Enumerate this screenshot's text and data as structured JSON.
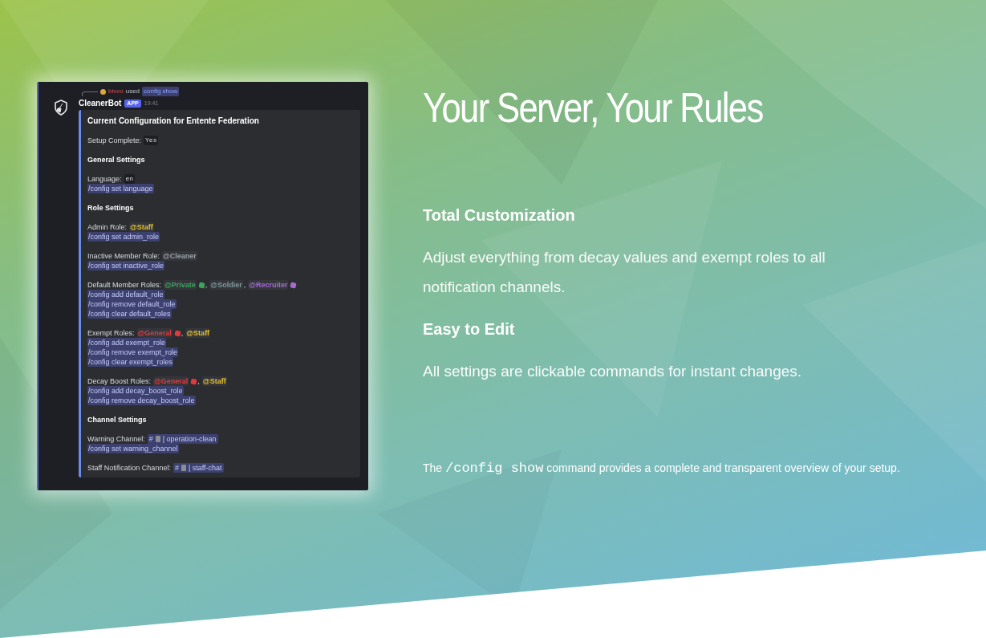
{
  "screenshot": {
    "reply": {
      "user": "bivvo",
      "verb": "used",
      "command": "config show"
    },
    "bot": {
      "name": "CleanerBot",
      "badge": "APP",
      "time": "19:41"
    },
    "embed": {
      "title": "Current Configuration for Entente Federation",
      "blocks": [
        {
          "kind": "field",
          "label": "Setup Complete:",
          "values": [
            {
              "kind": "code",
              "text": "Yes"
            }
          ]
        },
        {
          "kind": "heading",
          "text": "General Settings"
        },
        {
          "kind": "field",
          "label": "Language:",
          "values": [
            {
              "kind": "code",
              "text": "en"
            }
          ],
          "commands": [
            "/config set language"
          ]
        },
        {
          "kind": "heading",
          "text": "Role Settings"
        },
        {
          "kind": "field",
          "label": "Admin Role:",
          "values": [
            {
              "kind": "role",
              "text": "@Staff",
              "color": "#e8c12c",
              "has_icon": false
            }
          ],
          "commands": [
            "/config set admin_role"
          ]
        },
        {
          "kind": "field",
          "label": "Inactive Member Role:",
          "values": [
            {
              "kind": "role",
              "text": "@Cleaner",
              "color": "#9aa0a6",
              "has_icon": false
            }
          ],
          "commands": [
            "/config set inactive_role"
          ]
        },
        {
          "kind": "field",
          "label": "Default Member Roles:",
          "values": [
            {
              "kind": "role",
              "text": "@Private",
              "color": "#3ba55c",
              "has_icon": true
            },
            {
              "kind": "plain",
              "text": ","
            },
            {
              "kind": "role",
              "text": "@Soldier",
              "color": "#7f9c9c",
              "has_icon": false
            },
            {
              "kind": "plain",
              "text": ","
            },
            {
              "kind": "role",
              "text": "@Recruiter",
              "color": "#a56bd1",
              "has_icon": true
            }
          ],
          "commands": [
            "/config add default_role",
            "/config remove default_role",
            "/config clear default_roles"
          ]
        },
        {
          "kind": "field",
          "label": "Exempt Roles:",
          "values": [
            {
              "kind": "role",
              "text": "@General",
              "color": "#e03b3b",
              "has_icon": true
            },
            {
              "kind": "plain",
              "text": ","
            },
            {
              "kind": "role",
              "text": "@Staff",
              "color": "#e8c12c",
              "has_icon": false
            }
          ],
          "commands": [
            "/config add exempt_role",
            "/config remove exempt_role",
            "/config clear exempt_roles"
          ]
        },
        {
          "kind": "field",
          "label": "Decay Boost Roles:",
          "values": [
            {
              "kind": "role",
              "text": "@General",
              "color": "#e03b3b",
              "has_icon": true
            },
            {
              "kind": "plain",
              "text": ","
            },
            {
              "kind": "role",
              "text": "@Staff",
              "color": "#e8c12c",
              "has_icon": false
            }
          ],
          "commands": [
            "/config add decay_boost_role",
            "/config remove decay_boost_role"
          ]
        },
        {
          "kind": "heading",
          "text": "Channel Settings"
        },
        {
          "kind": "field",
          "label": "Warning Channel:",
          "values": [
            {
              "kind": "channel",
              "hash": "#",
              "name": "| operation-clean"
            }
          ],
          "commands": [
            "/config set warning_channel"
          ]
        },
        {
          "kind": "field",
          "label": "Staff Notification Channel:",
          "values": [
            {
              "kind": "channel",
              "hash": "#",
              "name": "| staff-chat"
            }
          ]
        }
      ]
    }
  },
  "headline": "Your Server, Your Rules",
  "features": [
    {
      "heading": "Total Customization",
      "body": "Adjust everything from decay values and exempt roles to all notification channels."
    },
    {
      "heading": "Easy to Edit",
      "body": "All settings are clickable commands for instant changes."
    }
  ],
  "footnote": {
    "before": "The",
    "code": "/config show",
    "after": "command provides a complete and transparent overview of your setup."
  }
}
